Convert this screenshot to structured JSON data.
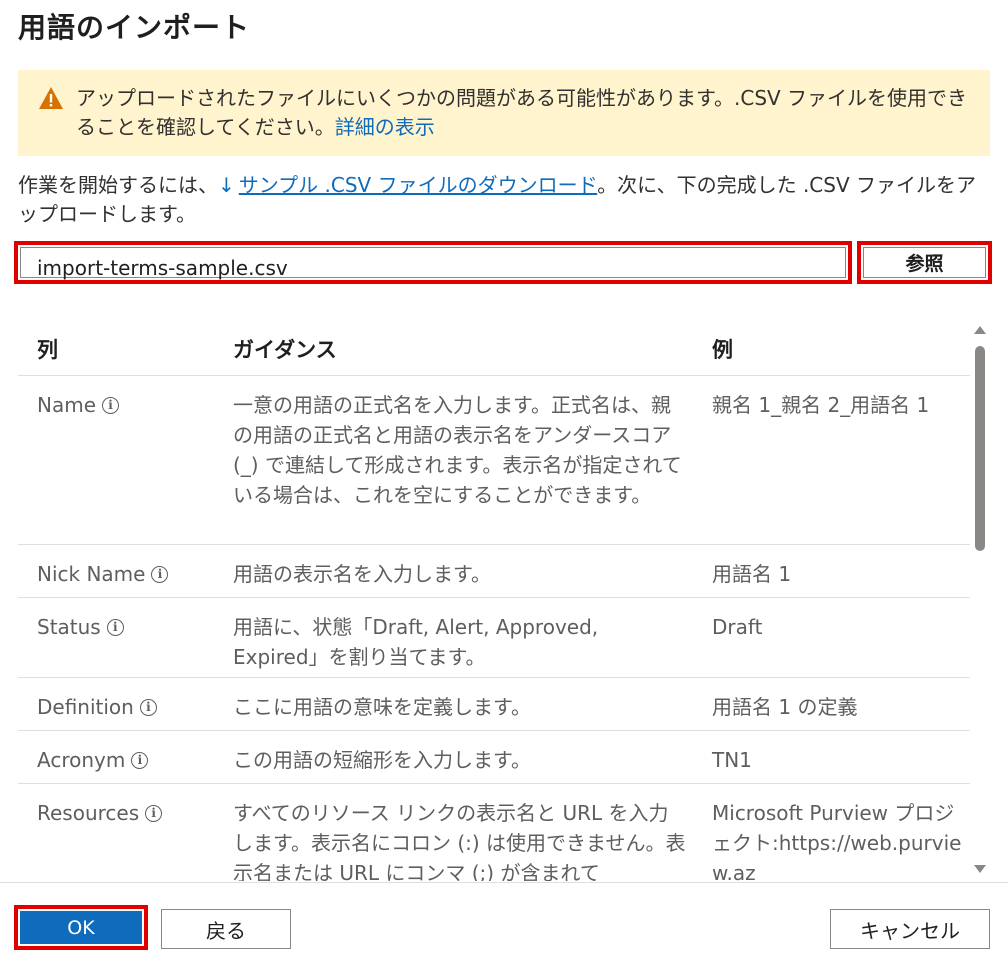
{
  "dialog": {
    "title": "用語のインポート"
  },
  "warning": {
    "text": "アップロードされたファイルにいくつかの問題がある可能性があります。.CSV ファイルを使用できることを確認してください。",
    "link": "詳細の表示",
    "icon": "warning-icon",
    "color": "#fff4ce"
  },
  "intro": {
    "before": "作業を開始するには、",
    "link": "サンプル .CSV ファイルのダウンロード",
    "after": "。次に、下の完成した .CSV ファイルをアップロードします。"
  },
  "file": {
    "value": "import-terms-sample.csv",
    "browse_label": "参照"
  },
  "table": {
    "headers": [
      "列",
      "ガイダンス",
      "例"
    ],
    "rows": [
      {
        "name": "Name",
        "guidance": "一意の用語の正式名を入力します。正式名は、親の用語の正式名と用語の表示名をアンダースコア (_) で連結して形成されます。表示名が指定されている場合は、これを空にすることができます。",
        "example": "親名 1_親名 2_用語名 1"
      },
      {
        "name": "Nick Name",
        "guidance": "用語の表示名を入力します。",
        "example": "用語名 1"
      },
      {
        "name": "Status",
        "guidance": "用語に、状態「Draft, Alert, Approved, Expired」を割り当てます。",
        "example": "Draft"
      },
      {
        "name": "Definition",
        "guidance": "ここに用語の意味を定義します。",
        "example": "用語名 1 の定義"
      },
      {
        "name": "Acronym",
        "guidance": "この用語の短縮形を入力します。",
        "example": "TN1"
      },
      {
        "name": "Resources",
        "guidance": "すべてのリソース リンクの表示名と URL を入力します。表示名にコロン (:) は使用できません。表示名または URL にコンマ (;) が含まれて",
        "example": "Microsoft Purview プロジェクト:https://web.purview.az"
      }
    ]
  },
  "footer": {
    "ok_label": "OK",
    "back_label": "戻る",
    "cancel_label": "キャンセル"
  },
  "colors": {
    "accent": "#0f6cbd",
    "highlight": "#e00000"
  }
}
